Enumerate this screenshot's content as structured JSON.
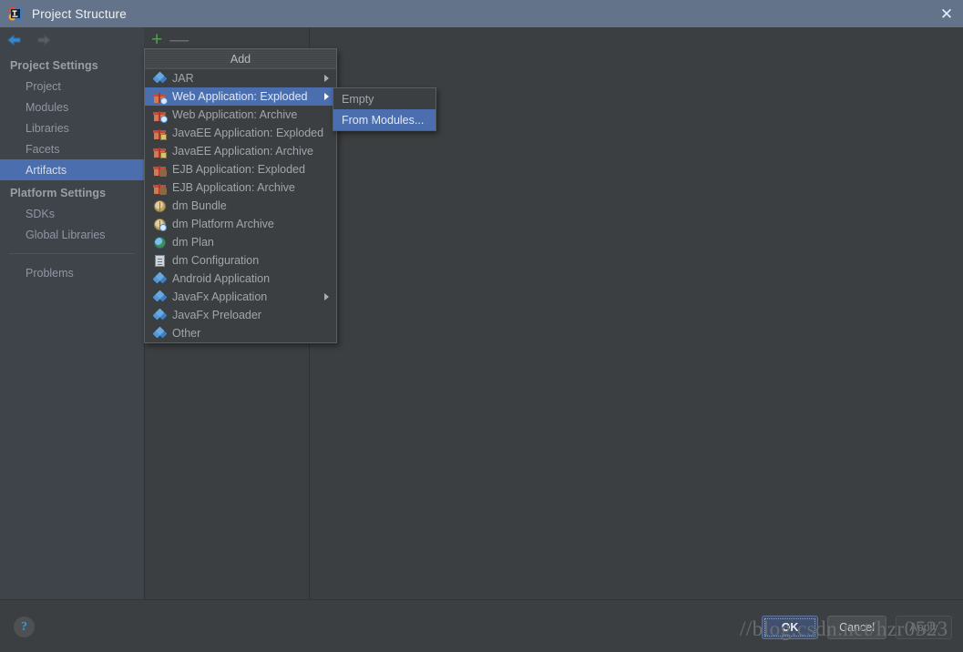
{
  "window": {
    "title": "Project Structure",
    "logo_icon": "intellij-idea-logo",
    "close_icon": "close-icon"
  },
  "sidebar": {
    "nav": {
      "back_icon": "arrow-left-icon",
      "forward_icon": "arrow-right-icon"
    },
    "groups": [
      {
        "title": "Project Settings",
        "items": [
          {
            "label": "Project",
            "selected": false
          },
          {
            "label": "Modules",
            "selected": false
          },
          {
            "label": "Libraries",
            "selected": false
          },
          {
            "label": "Facets",
            "selected": false
          },
          {
            "label": "Artifacts",
            "selected": true
          }
        ]
      },
      {
        "title": "Platform Settings",
        "items": [
          {
            "label": "SDKs",
            "selected": false
          },
          {
            "label": "Global Libraries",
            "selected": false
          }
        ]
      }
    ],
    "footer_items": [
      {
        "label": "Problems",
        "selected": false
      }
    ],
    "selected_color": "#4b6eaf"
  },
  "toolbar": {
    "add_label": "+",
    "add_icon": "plus-icon",
    "remove_label": "—",
    "remove_icon": "minus-icon",
    "add_color": "#4f9e52",
    "remove_color": "#6e7276"
  },
  "menu": {
    "header": "Add",
    "items": [
      {
        "label": "JAR",
        "icon": "jar-icon",
        "has_submenu": true,
        "highlighted": false
      },
      {
        "label": "Web Application: Exploded",
        "icon": "web-exploded-icon",
        "has_submenu": true,
        "highlighted": true
      },
      {
        "label": "Web Application: Archive",
        "icon": "web-archive-icon",
        "has_submenu": false,
        "highlighted": false
      },
      {
        "label": "JavaEE Application: Exploded",
        "icon": "javaee-exploded-icon",
        "has_submenu": false,
        "highlighted": false
      },
      {
        "label": "JavaEE Application: Archive",
        "icon": "javaee-archive-icon",
        "has_submenu": false,
        "highlighted": false
      },
      {
        "label": "EJB Application: Exploded",
        "icon": "ejb-exploded-icon",
        "has_submenu": false,
        "highlighted": false
      },
      {
        "label": "EJB Application: Archive",
        "icon": "ejb-archive-icon",
        "has_submenu": false,
        "highlighted": false
      },
      {
        "label": "dm Bundle",
        "icon": "dm-bundle-icon",
        "has_submenu": false,
        "highlighted": false
      },
      {
        "label": "dm Platform Archive",
        "icon": "dm-platform-archive-icon",
        "has_submenu": false,
        "highlighted": false
      },
      {
        "label": "dm Plan",
        "icon": "dm-plan-globe-icon",
        "has_submenu": false,
        "highlighted": false
      },
      {
        "label": "dm Configuration",
        "icon": "dm-configuration-file-icon",
        "has_submenu": false,
        "highlighted": false
      },
      {
        "label": "Android Application",
        "icon": "android-application-icon",
        "has_submenu": false,
        "highlighted": false
      },
      {
        "label": "JavaFx Application",
        "icon": "javafx-application-icon",
        "has_submenu": true,
        "highlighted": false
      },
      {
        "label": "JavaFx Preloader",
        "icon": "javafx-preloader-icon",
        "has_submenu": false,
        "highlighted": false
      },
      {
        "label": "Other",
        "icon": "other-icon",
        "has_submenu": false,
        "highlighted": false
      }
    ]
  },
  "submenu": {
    "items": [
      {
        "label": "Empty",
        "highlighted": false
      },
      {
        "label": "From Modules...",
        "highlighted": true
      }
    ]
  },
  "bottom": {
    "help_label": "?",
    "help_icon": "help-question-icon",
    "watermark": "//blog.csdn.net/hzr0523",
    "buttons": [
      {
        "label": "OK",
        "style": "default"
      },
      {
        "label": "Cancel",
        "style": "normal"
      },
      {
        "label": "Apply",
        "style": "disabled"
      }
    ]
  }
}
